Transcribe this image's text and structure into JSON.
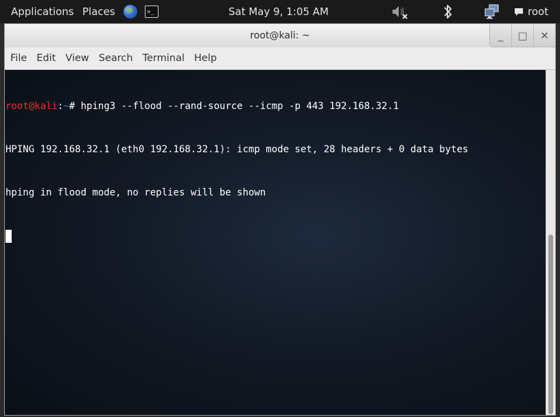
{
  "top_panel": {
    "applications_label": "Applications",
    "places_label": "Places",
    "clock": "Sat May  9,  1:05 AM",
    "user_label": "root",
    "terminal_launcher_glyph": ">_",
    "icons": [
      "globe-browser-icon",
      "terminal-launcher-icon",
      "volume-muted-icon",
      "bluetooth-icon",
      "network-icon",
      "chat-bubble-icon"
    ]
  },
  "window": {
    "title": "root@kali: ~",
    "buttons": {
      "minimize": "_",
      "maximize": "□",
      "close": "✕"
    }
  },
  "menubar": {
    "items": [
      "File",
      "Edit",
      "View",
      "Search",
      "Terminal",
      "Help"
    ]
  },
  "terminal": {
    "prompt_user": "root@kali",
    "prompt_colon": ":",
    "prompt_path": "~",
    "prompt_symbol": "#",
    "command": " hping3 --flood --rand-source --icmp -p 443 192.168.32.1",
    "output": [
      "HPING 192.168.32.1 (eth0 192.168.32.1): icmp mode set, 28 headers + 0 data bytes",
      "hping in flood mode, no replies will be shown"
    ]
  },
  "colors": {
    "prompt_user": "#e53232",
    "prompt_path": "#3f7ce8",
    "terminal_text": "#ffffff",
    "terminal_bg": "#121a26"
  }
}
